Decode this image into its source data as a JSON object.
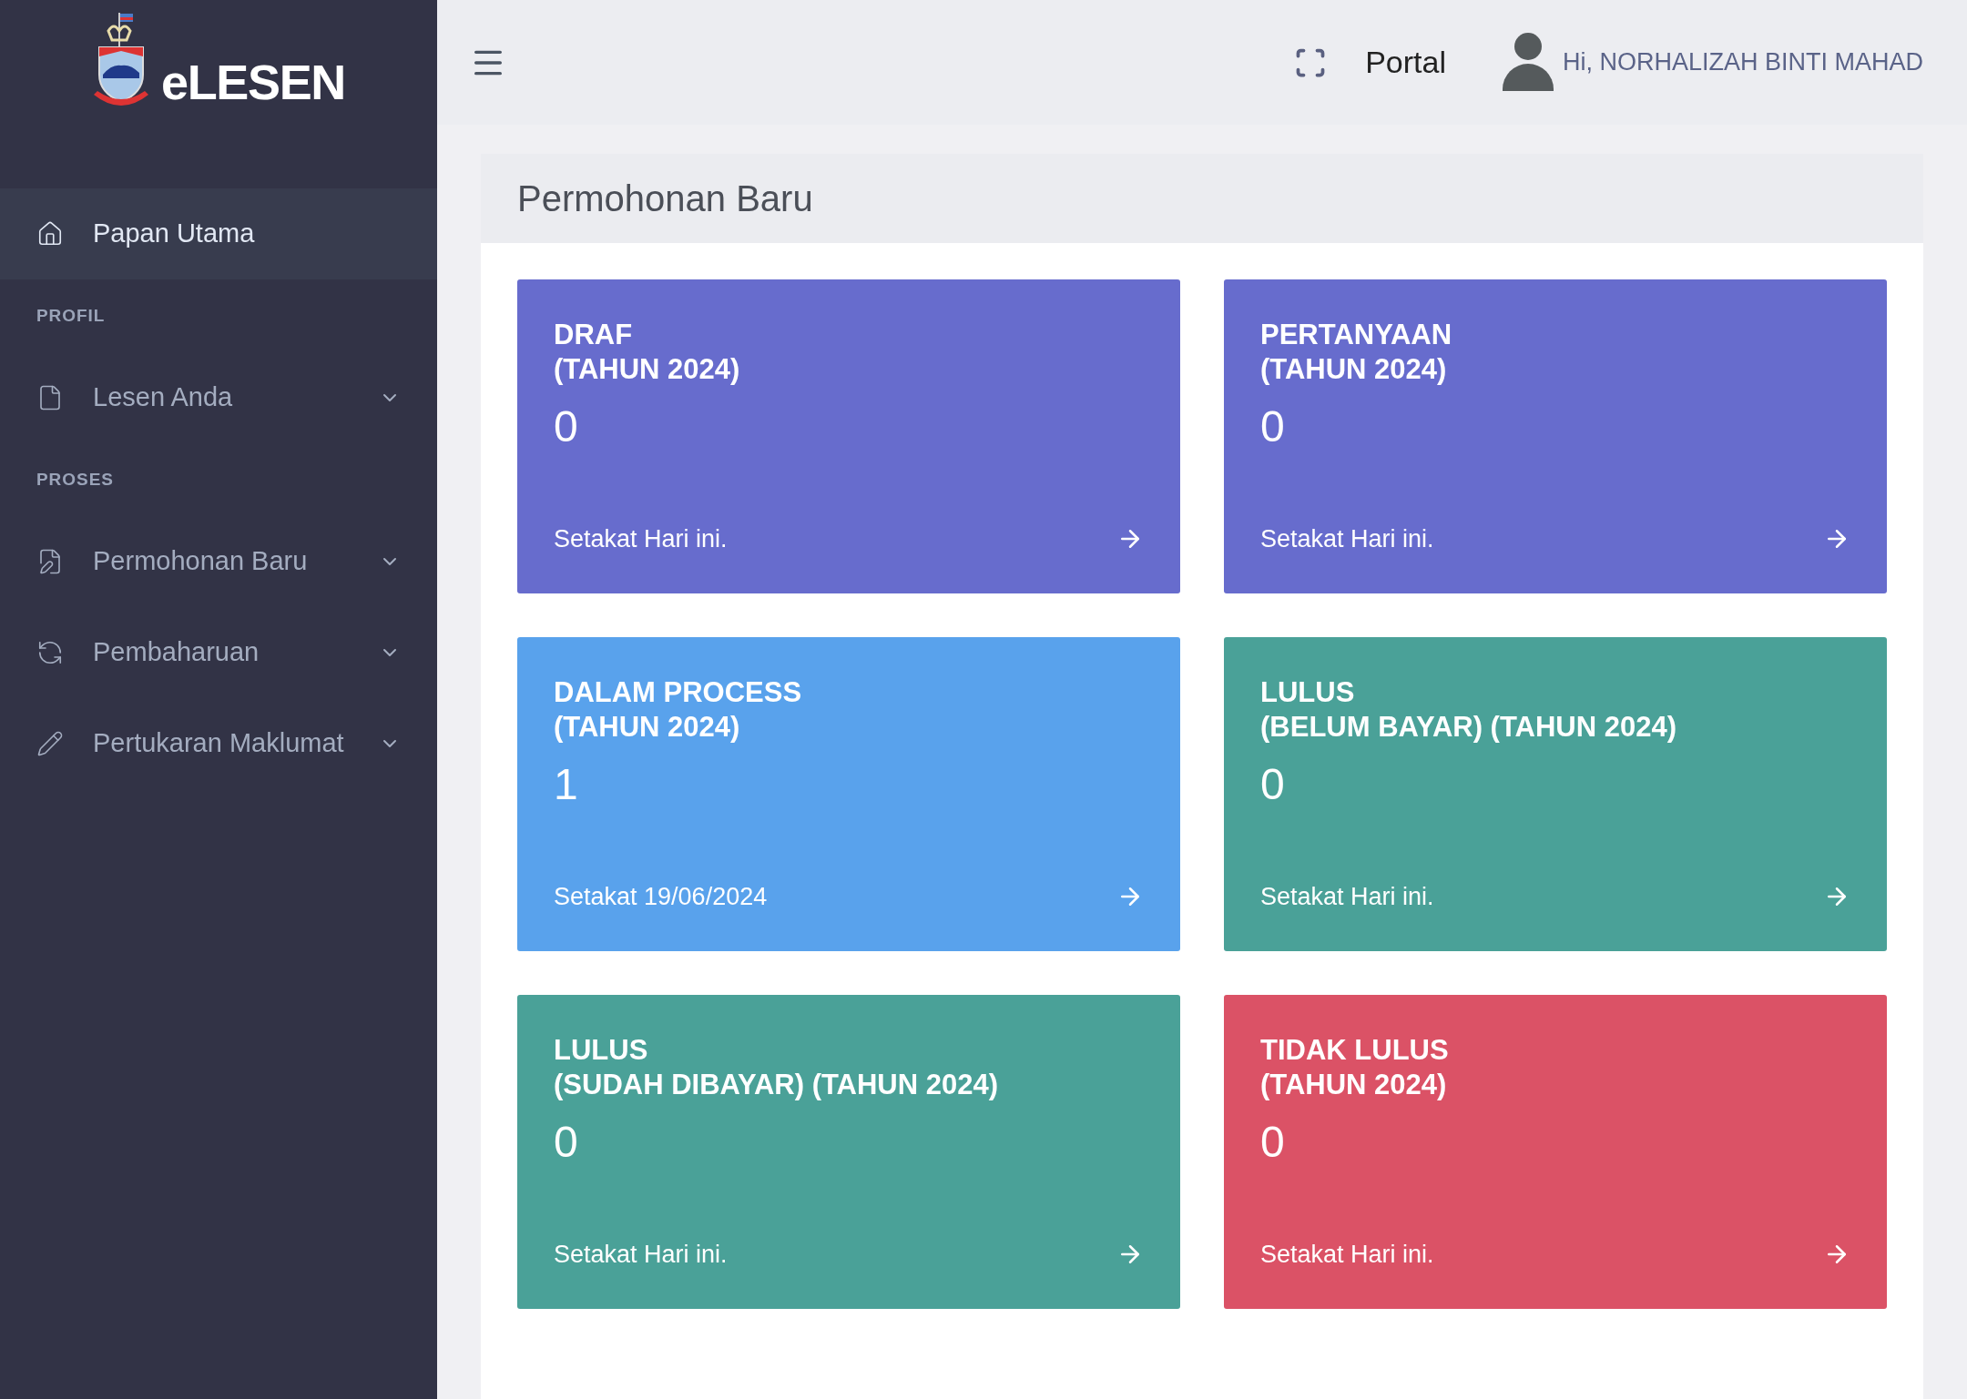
{
  "brand": {
    "name": "eLESEN"
  },
  "sidebar": {
    "items": [
      {
        "kind": "link",
        "label": "Papan Utama",
        "selected": true
      },
      {
        "kind": "heading",
        "label": "PROFIL"
      },
      {
        "kind": "dropdown",
        "label": "Lesen Anda",
        "selected": false
      },
      {
        "kind": "heading",
        "label": "PROSES"
      },
      {
        "kind": "dropdown",
        "label": "Permohonan Baru",
        "selected": false
      },
      {
        "kind": "dropdown",
        "label": "Pembaharuan",
        "selected": false
      },
      {
        "kind": "dropdown",
        "label": "Pertukaran Maklumat",
        "selected": false
      }
    ]
  },
  "header": {
    "portal_link": "Portal",
    "user_greeting": "Hi, NORHALIZAH BINTI MAHAD"
  },
  "panel": {
    "title": "Permohonan Baru",
    "cards": [
      {
        "title": "DRAF",
        "subtitle": "(TAHUN 2024)",
        "count": "0",
        "footer": "Setakat Hari ini.",
        "color": "#676ccd"
      },
      {
        "title": "PERTANYAAN",
        "subtitle": "(TAHUN 2024)",
        "count": "0",
        "footer": "Setakat Hari ini.",
        "color": "#676ccd"
      },
      {
        "title": "DALAM PROCESS",
        "subtitle": "(TAHUN 2024)",
        "count": "1",
        "footer": "Setakat 19/06/2024",
        "color": "#59a2ec"
      },
      {
        "title": "LULUS",
        "subtitle": "(BELUM BAYAR) (TAHUN 2024)",
        "count": "0",
        "footer": "Setakat Hari ini.",
        "color": "#4aa198"
      },
      {
        "title": "LULUS",
        "subtitle": "(SUDAH DIBAYAR) (TAHUN 2024)",
        "count": "0",
        "footer": "Setakat Hari ini.",
        "color": "#4aa198"
      },
      {
        "title": "TIDAK LULUS",
        "subtitle": "(TAHUN 2024)",
        "count": "0",
        "footer": "Setakat Hari ini.",
        "color": "#db5266"
      }
    ]
  }
}
